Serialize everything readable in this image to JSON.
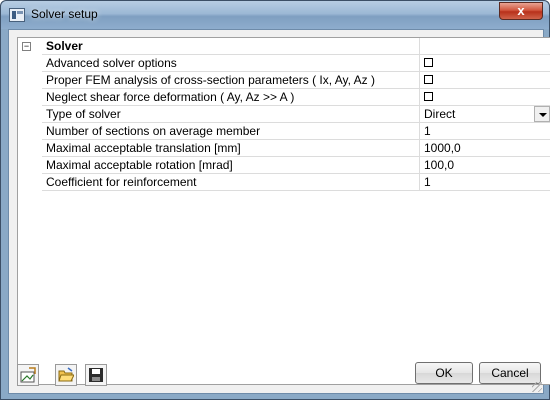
{
  "window": {
    "title": "Solver setup",
    "close_glyph": "x"
  },
  "grid": {
    "section_title": "Solver",
    "expander_glyph": "−",
    "rows": [
      {
        "label": "Advanced solver options",
        "type": "checkbox",
        "value": ""
      },
      {
        "label": "Proper FEM analysis of cross-section parameters ( Ix, Ay, Az )",
        "type": "checkbox",
        "value": ""
      },
      {
        "label": "Neglect shear force deformation ( Ay, Az >> A )",
        "type": "checkbox",
        "value": ""
      },
      {
        "label": "Type of solver",
        "type": "dropdown",
        "value": "Direct"
      },
      {
        "label": "Number of sections on average member",
        "type": "text",
        "value": "1"
      },
      {
        "label": "Maximal acceptable translation [mm]",
        "type": "text",
        "value": "1000,0"
      },
      {
        "label": "Maximal acceptable rotation [mrad]",
        "type": "text",
        "value": "100,0"
      },
      {
        "label": "Coefficient for reinforcement",
        "type": "text",
        "value": "1"
      }
    ]
  },
  "toolbar": {
    "icons": [
      "defaults-icon",
      "open-folder-icon",
      "save-icon"
    ]
  },
  "buttons": {
    "ok_label": "OK",
    "cancel_label": "Cancel"
  }
}
